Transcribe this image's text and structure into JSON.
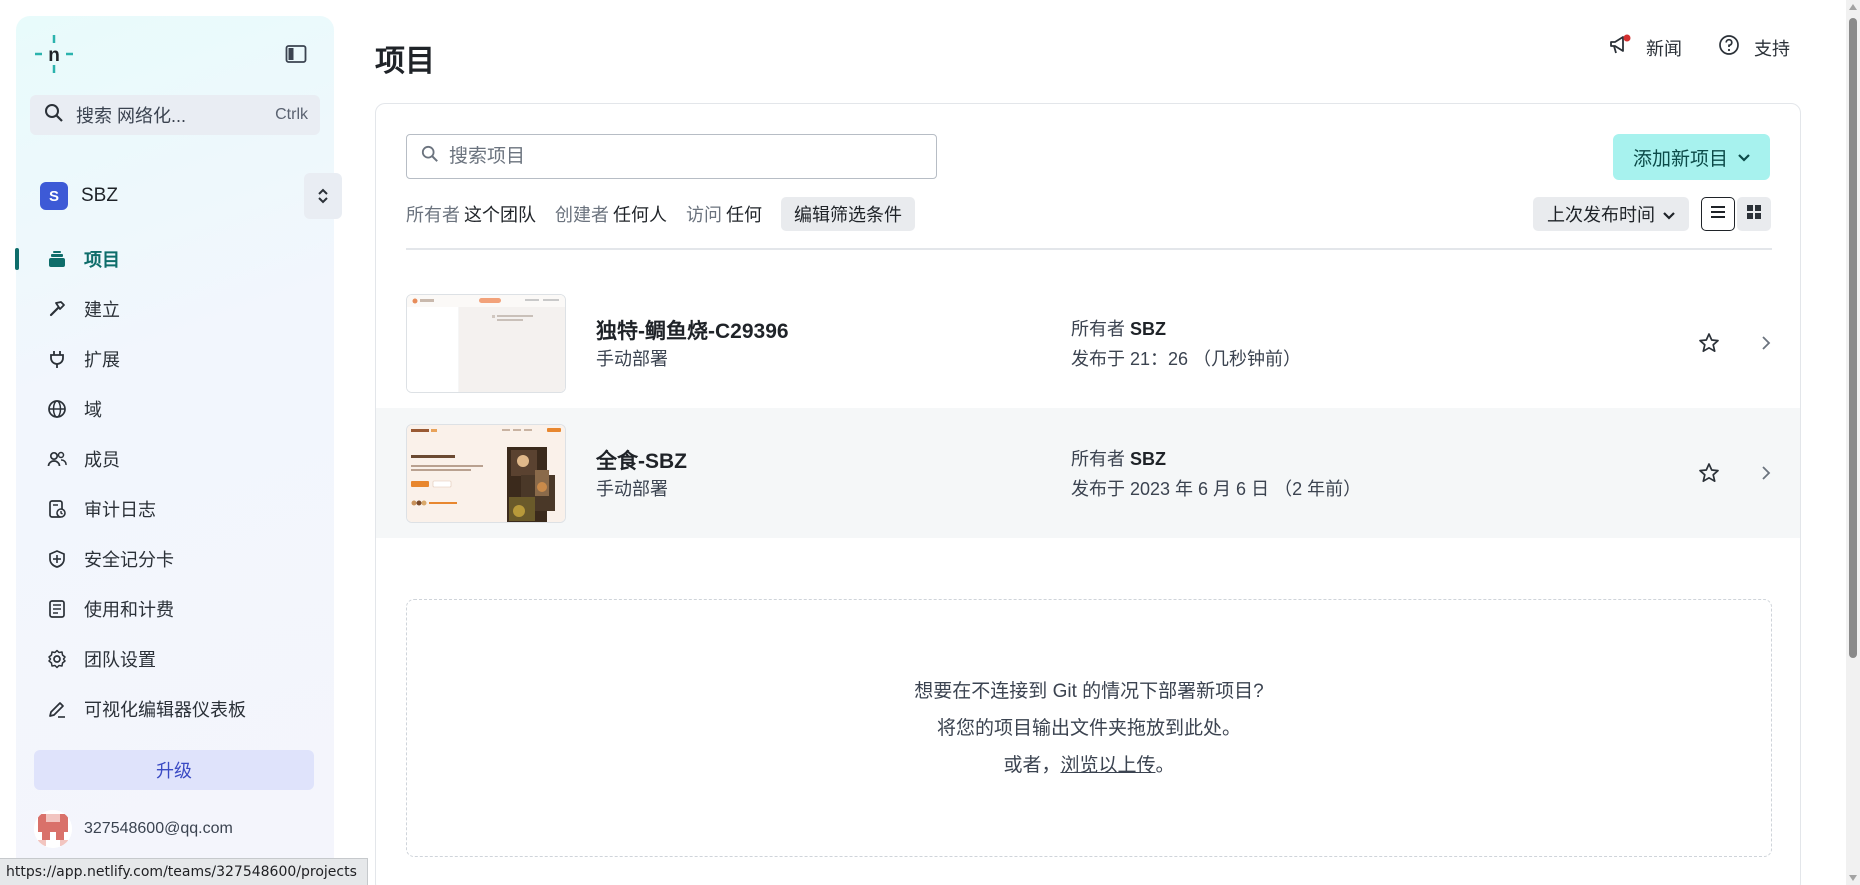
{
  "sidebar": {
    "search": {
      "label": "搜索 网络化...",
      "shortcut": "Ctrlk"
    },
    "team": {
      "initial": "S",
      "name": "SBZ"
    },
    "nav": [
      {
        "label": "项目",
        "icon": "layers-icon",
        "active": true
      },
      {
        "label": "建立",
        "icon": "hammer-icon"
      },
      {
        "label": "扩展",
        "icon": "plug-icon"
      },
      {
        "label": "域",
        "icon": "globe-icon"
      },
      {
        "label": "成员",
        "icon": "users-icon"
      },
      {
        "label": "审计日志",
        "icon": "audit-log-icon"
      },
      {
        "label": "安全记分卡",
        "icon": "shield-icon"
      },
      {
        "label": "使用和计费",
        "icon": "billing-icon"
      },
      {
        "label": "团队设置",
        "icon": "gear-icon"
      },
      {
        "label": "可视化编辑器仪表板",
        "icon": "pencil-icon"
      }
    ],
    "upgrade_label": "升级",
    "user_email": "327548600@qq.com"
  },
  "header": {
    "title": "项目",
    "news_label": "新闻",
    "support_label": "支持"
  },
  "toolbar": {
    "search_placeholder": "搜索项目",
    "add_button": "添加新项目",
    "filters": [
      {
        "key": "所有者",
        "value": "这个团队"
      },
      {
        "key": "创建者",
        "value": "任何人"
      },
      {
        "key": "访问",
        "value": "任何"
      }
    ],
    "edit_filters": "编辑筛选条件",
    "sort_label": "上次发布时间"
  },
  "projects": [
    {
      "name": "独特-鲷鱼烧-C29396",
      "deploy": "手动部署",
      "owner_prefix": "所有者",
      "owner": "SBZ",
      "published": "发布于 21：26 （几秒钟前）"
    },
    {
      "name": "全食-SBZ",
      "deploy": "手动部署",
      "owner_prefix": "所有者",
      "owner": "SBZ",
      "published": "发布于 2023 年 6 月 6 日 （2 年前）"
    }
  ],
  "dropzone": {
    "line1": "想要在不连接到 Git 的情况下部署新项目?",
    "line2": "将您的项目输出文件夹拖放到此处。",
    "line3_prefix": "或者，",
    "line3_link": "浏览以上传",
    "line3_suffix": "。"
  },
  "status_url": "https://app.netlify.com/teams/327548600/projects",
  "colors": {
    "accent": "#0e6d6a",
    "add_button_bg": "#a7f2ee",
    "team_avatar": "#3d5ad6",
    "news_dot": "#d32f2f"
  }
}
